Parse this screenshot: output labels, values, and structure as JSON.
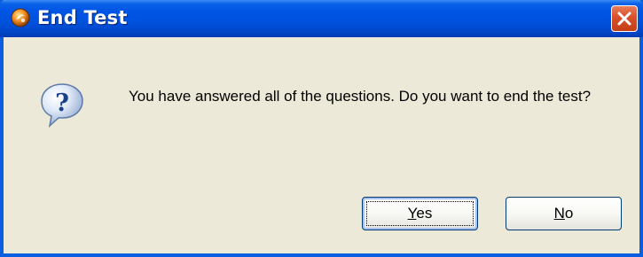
{
  "window": {
    "title": "End Test",
    "app_icon": "app-logo-icon",
    "close_icon": "close-icon"
  },
  "dialog": {
    "icon": "question-icon",
    "message": "You have answered all of the questions.  Do you want to end the test?",
    "buttons": [
      {
        "label_mnemonic": "Y",
        "label_rest": "es",
        "label": "Yes",
        "default": true
      },
      {
        "label_mnemonic": "N",
        "label_rest": "o",
        "label": "No",
        "default": false
      }
    ]
  },
  "colors": {
    "titlebar": "#0055e5",
    "window_border": "#0a5ee0",
    "dialog_background": "#ece9d8",
    "close_button": "#d8502a",
    "button_border": "#003c74"
  }
}
